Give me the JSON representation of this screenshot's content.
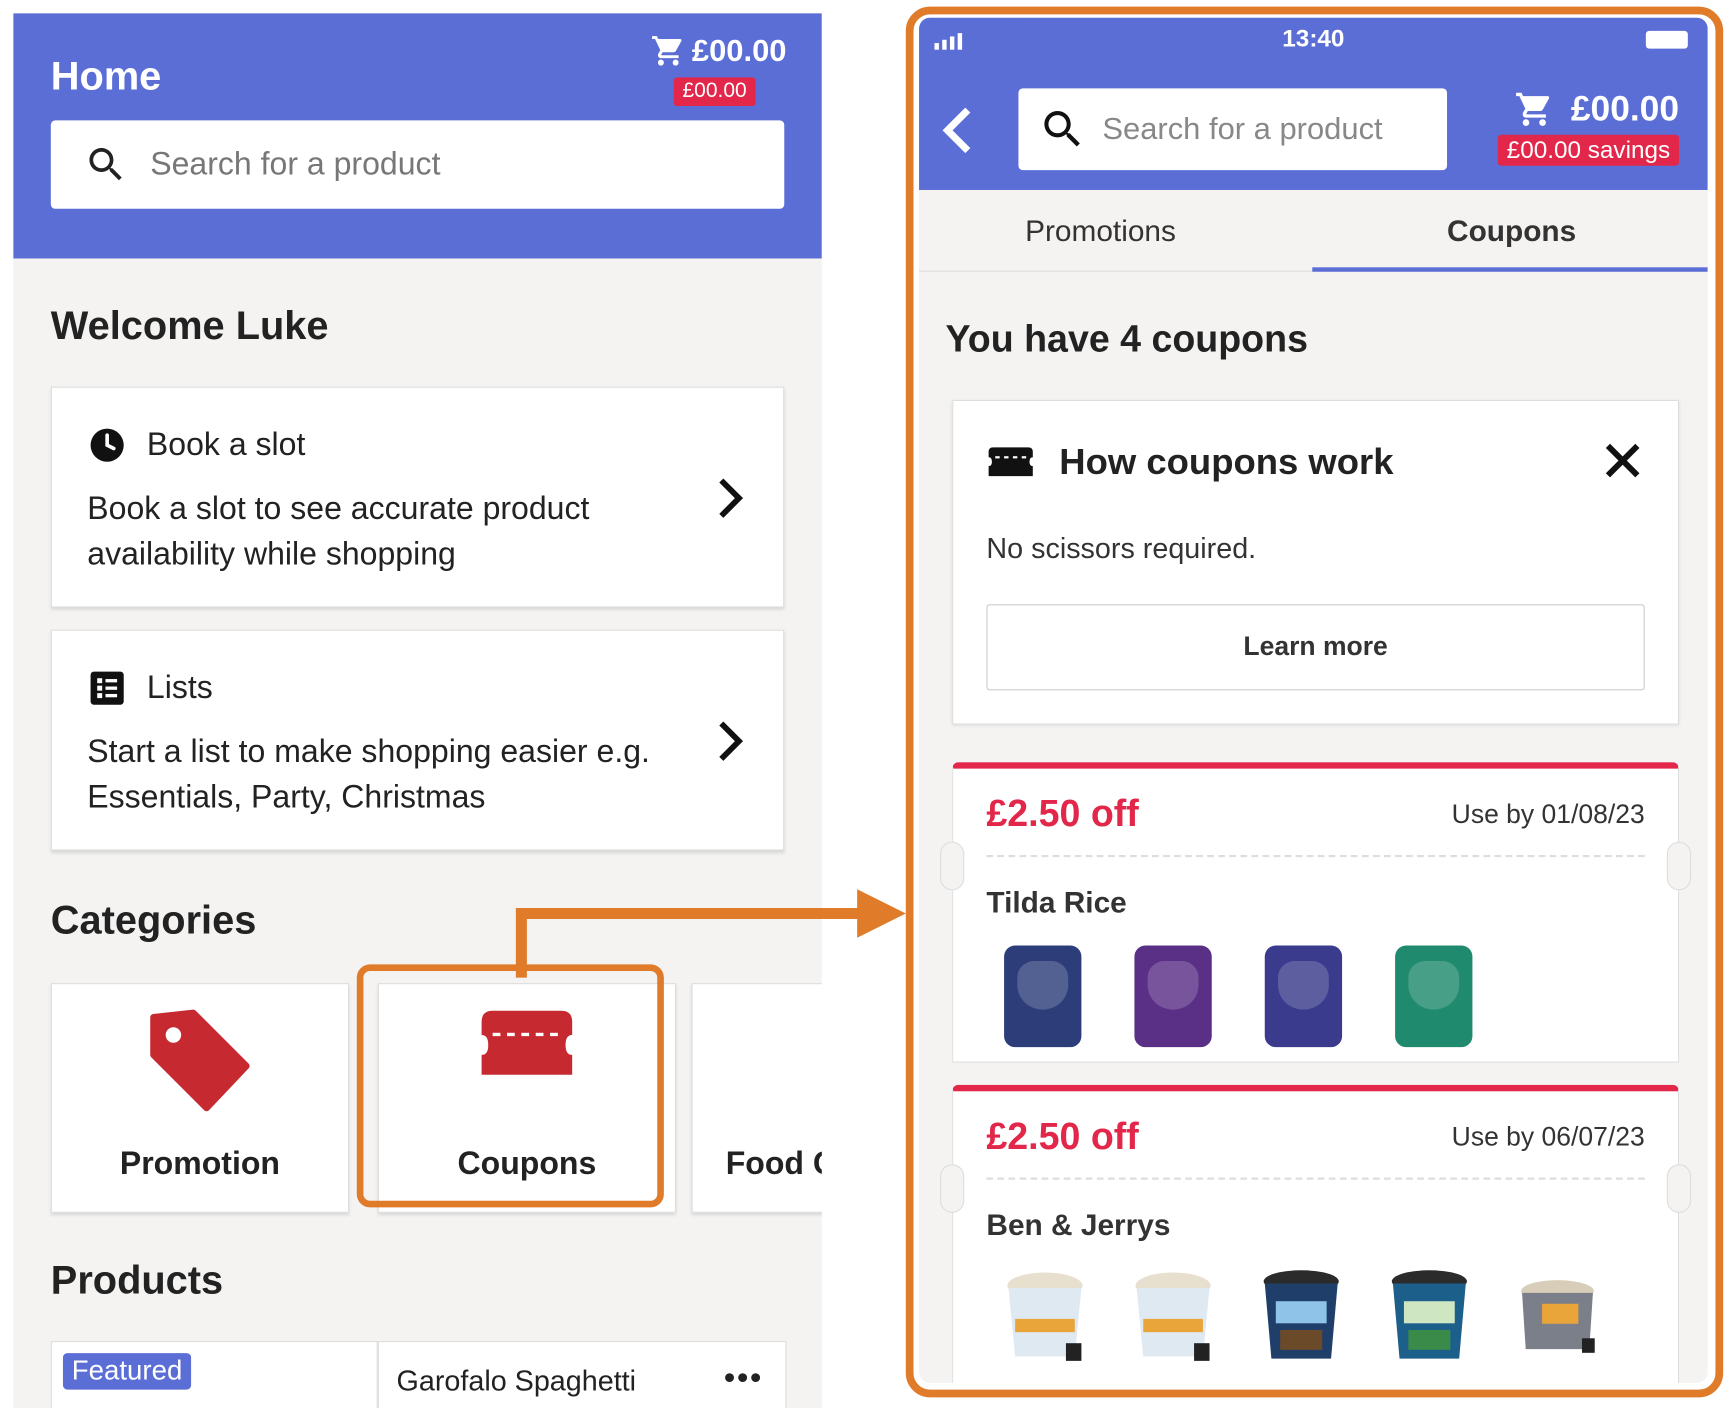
{
  "left_screen": {
    "header": {
      "title": "Home",
      "cart_total": "£00.00",
      "cart_badge": "£00.00",
      "search_placeholder": "Search for a product"
    },
    "welcome": "Welcome Luke",
    "cards": [
      {
        "icon": "clock-icon",
        "title": "Book a slot",
        "description": "Book a slot to see accurate product availability while shopping"
      },
      {
        "icon": "list-icon",
        "title": "Lists",
        "description": "Start a list to make shopping easier e.g. Essentials, Party, Christmas"
      }
    ],
    "categories_heading": "Categories",
    "categories": [
      {
        "icon": "tag-icon",
        "label": "Promotion"
      },
      {
        "icon": "coupon-icon",
        "label": "Coupons",
        "highlighted": true
      },
      {
        "icon": "jar-icon",
        "label": "Food C"
      }
    ],
    "products_heading": "Products",
    "products": [
      {
        "badge": "Featured"
      },
      {
        "name": "Garofalo Spaghetti",
        "menu": "•••"
      }
    ]
  },
  "right_screen": {
    "status_bar": {
      "time": "13:40"
    },
    "header": {
      "search_placeholder": "Search for a product",
      "cart_total": "£00.00",
      "savings": "£00.00 savings"
    },
    "tabs": [
      {
        "label": "Promotions",
        "active": false
      },
      {
        "label": "Coupons",
        "active": true
      }
    ],
    "coupon_count_text": "You have 4 coupons",
    "info_card": {
      "icon": "ticket-icon",
      "title": "How coupons work",
      "description": "No scissors required.",
      "button": "Learn more"
    },
    "coupons": [
      {
        "discount": "£2.50 off",
        "use_by": "Use by 01/08/23",
        "brand": "Tilda Rice",
        "product_count": 4
      },
      {
        "discount": "£2.50 off",
        "use_by": "Use by 06/07/23",
        "brand": "Ben & Jerrys",
        "product_count": 5
      }
    ]
  },
  "colors": {
    "header_blue": "#5b6ed6",
    "accent_red": "#e2274a",
    "highlight_orange": "#e07b2a",
    "category_icon_red": "#c62a30"
  }
}
